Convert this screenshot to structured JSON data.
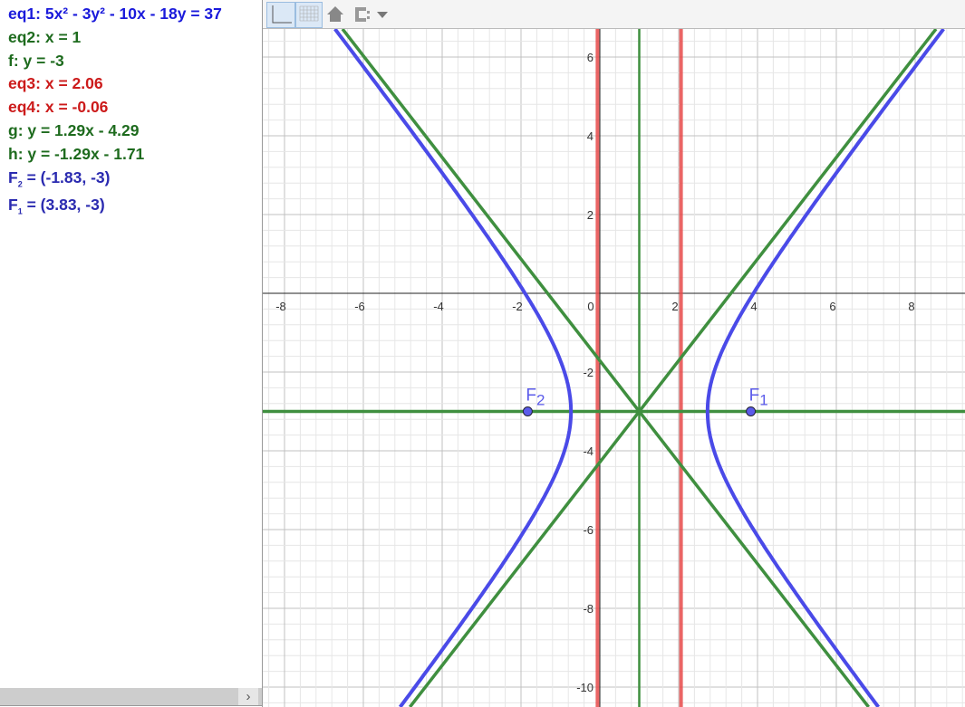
{
  "algebra": {
    "items": [
      {
        "text": "eq1: 5x² - 3y² - 10x - 18y = 37",
        "color": "#1a1adb"
      },
      {
        "text": "eq2: x = 1",
        "color": "#1e6b1e"
      },
      {
        "text": "f: y = -3",
        "color": "#1e6b1e"
      },
      {
        "text": "eq3: x = 2.06",
        "color": "#cc1a1a"
      },
      {
        "text": "eq4: x = -0.06",
        "color": "#cc1a1a"
      },
      {
        "text": "g: y = 1.29x - 4.29",
        "color": "#1e6b1e"
      },
      {
        "text": "h: y = -1.29x - 1.71",
        "color": "#1e6b1e"
      }
    ],
    "points": [
      {
        "name": "F",
        "sub": "2",
        "value": " = (-1.83, -3)"
      },
      {
        "name": "F",
        "sub": "1",
        "value": " = (3.83, -3)"
      }
    ],
    "scroll_arrow": "›"
  },
  "toolbar": {
    "icons": [
      "axes-toggle-icon",
      "grid-toggle-icon",
      "home-icon",
      "point-capture-icon",
      "dropdown-icon"
    ]
  },
  "graph": {
    "x_ticks": [
      -8,
      -6,
      -4,
      -2,
      0,
      2,
      4,
      6,
      8
    ],
    "y_ticks": [
      6,
      4,
      2,
      -2,
      -4,
      -6,
      -8,
      -10
    ],
    "colors": {
      "hyperbola": "#4a4ae8",
      "green": "#3f8f3f",
      "red": "#e84a4a",
      "point": "#5b5bea"
    },
    "hyperbola": {
      "h": 1,
      "k": -3,
      "a2": 3,
      "b2": 5
    },
    "vlines_green": [
      1
    ],
    "hlines_green": [
      -3
    ],
    "vlines_red": [
      2.06,
      -0.06
    ],
    "lines": [
      {
        "m": 1.29,
        "c": -4.29
      },
      {
        "m": -1.29,
        "c": -1.71
      }
    ],
    "points": [
      {
        "label": "F",
        "sub": "2",
        "x": -1.83,
        "y": -3
      },
      {
        "label": "F",
        "sub": "1",
        "x": 3.83,
        "y": -3
      }
    ]
  }
}
